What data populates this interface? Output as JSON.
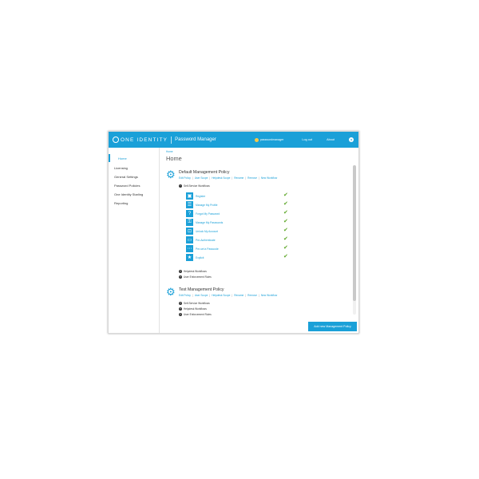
{
  "header": {
    "brand": "ONE IDENTITY",
    "product": "Password Manager",
    "user": "passwordmanager",
    "logout": "Log out",
    "about": "About",
    "help": "?"
  },
  "sidebar": {
    "items": [
      {
        "label": "Home",
        "active": true
      },
      {
        "label": "Licensing"
      },
      {
        "label": "General Settings"
      },
      {
        "label": "Password Policies"
      },
      {
        "label": "One Identity Starling"
      },
      {
        "label": "Reporting"
      }
    ]
  },
  "main": {
    "breadcrumb": "Home",
    "title": "Home",
    "policies": [
      {
        "title": "Default Management Policy",
        "links": [
          "Edit Policy",
          "User Scope",
          "Helpdesk Scope",
          "Rename",
          "Remove",
          "New Workflow"
        ],
        "sections": {
          "self_service": "Self-Service Workflows",
          "helpdesk": "Helpdesk Workflows",
          "user_enforcement": "User Enforcement Rules"
        },
        "workflows": [
          {
            "label": "Register",
            "icon": "register-icon"
          },
          {
            "label": "Manage My Profile",
            "icon": "profile-icon"
          },
          {
            "label": "Forgot My Password",
            "icon": "forgot-password-icon"
          },
          {
            "label": "Manage My Passwords",
            "icon": "passwords-icon"
          },
          {
            "label": "Unlock My Account",
            "icon": "unlock-icon"
          },
          {
            "label": "Pre-Authenticate",
            "icon": "preauth-icon"
          },
          {
            "label": "Pre-set a Passcode",
            "icon": "passcode-icon"
          },
          {
            "label": "Explicit",
            "icon": "explicit-icon"
          }
        ]
      },
      {
        "title": "Test Management Policy",
        "links": [
          "Edit Policy",
          "User Scope",
          "Helpdesk Scope",
          "Rename",
          "Remove",
          "New Workflow"
        ],
        "sections": {
          "self_service": "Self-Service Workflows",
          "helpdesk": "Helpdesk Workflows",
          "user_enforcement": "User Enforcement Rules"
        }
      }
    ],
    "add_button": "Add new Management Policy"
  },
  "colors": {
    "accent": "#1aa0d8",
    "check": "#5fa82a"
  }
}
